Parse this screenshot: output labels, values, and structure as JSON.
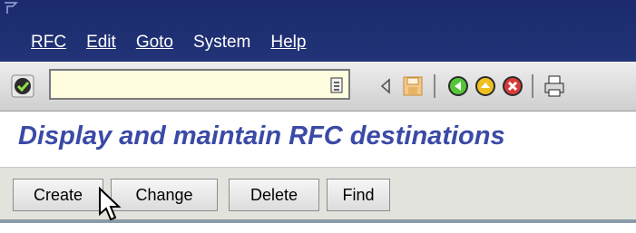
{
  "menu": {
    "items": [
      "RFC",
      "Edit",
      "Goto",
      "System",
      "Help"
    ],
    "underline_index": [
      0,
      0,
      0,
      1,
      0
    ]
  },
  "toolbar": {
    "command_field_value": "",
    "icons": [
      "enter-icon",
      "command-dropdown-icon",
      "back-arrow-icon",
      "save-icon",
      "back-icon",
      "exit-icon",
      "cancel-icon",
      "print-icon"
    ]
  },
  "title": "Display and maintain RFC destinations",
  "app_toolbar": {
    "buttons": [
      "Create",
      "Change",
      "Delete",
      "Find"
    ]
  },
  "colors": {
    "menubar": "#1a2a6c",
    "title": "#3a4aa6",
    "toolbar": "#dcdcdc",
    "command_field": "#fffde0"
  }
}
